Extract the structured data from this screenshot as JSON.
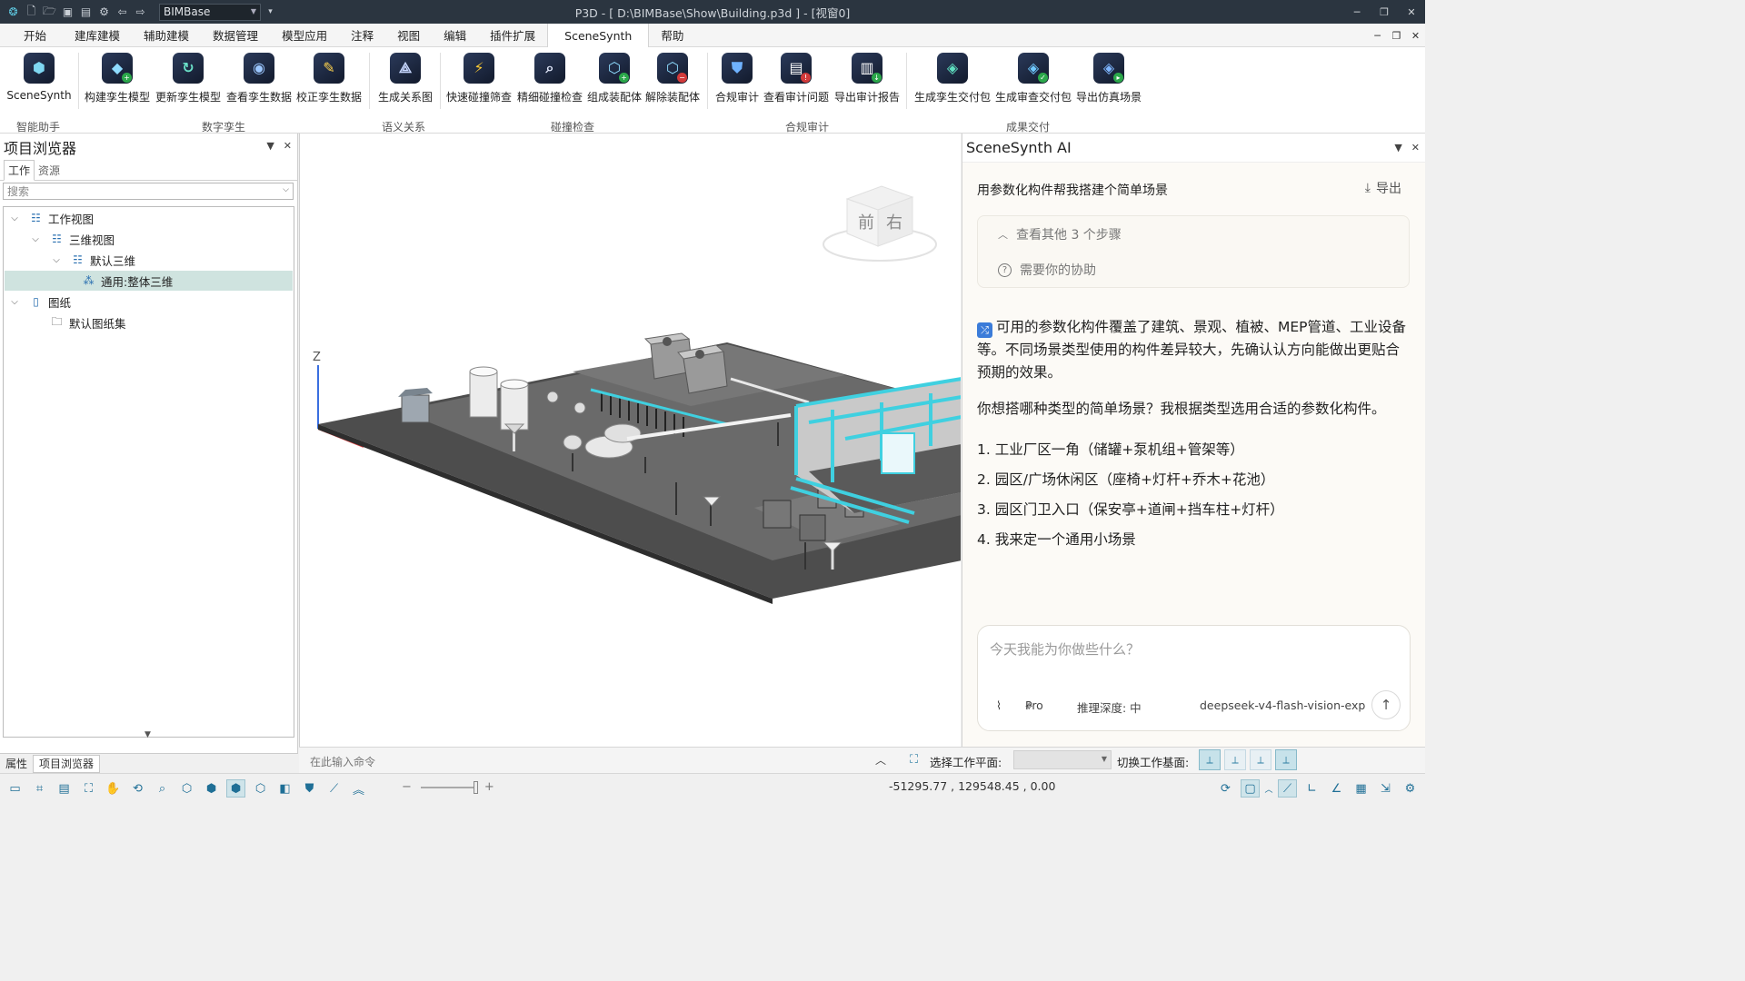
{
  "titlebar": {
    "app_select": "BIMBase",
    "title": "P3D - [ D:\\BIMBase\\Show\\Building.p3d ] - [视窗0]",
    "quick_access": [
      "app-logo-icon",
      "new-file-icon",
      "open-folder-icon",
      "save-icon",
      "save-as-icon",
      "settings-icon",
      "undo-icon",
      "redo-icon"
    ]
  },
  "menu": {
    "tabs": [
      "开始",
      "建库建模",
      "辅助建模",
      "数据管理",
      "模型应用",
      "注释",
      "视图",
      "编辑",
      "插件扩展",
      "SceneSynth",
      "帮助"
    ],
    "active": "SceneSynth"
  },
  "ribbon": {
    "buttons": [
      {
        "label": "SceneSynth",
        "icon": "scenesynth-cube-icon"
      },
      {
        "label": "构建孪生模型",
        "icon": "build-twin-model-icon"
      },
      {
        "label": "更新孪生模型",
        "icon": "update-twin-model-icon"
      },
      {
        "label": "查看孪生数据",
        "icon": "view-twin-data-icon"
      },
      {
        "label": "校正孪生数据",
        "icon": "correct-twin-data-icon"
      },
      {
        "label": "生成关系图",
        "icon": "relation-graph-icon"
      },
      {
        "label": "快速碰撞筛查",
        "icon": "quick-clash-icon"
      },
      {
        "label": "精细碰撞检查",
        "icon": "fine-clash-icon"
      },
      {
        "label": "组成装配体",
        "icon": "assemble-icon"
      },
      {
        "label": "解除装配体",
        "icon": "disassemble-icon"
      },
      {
        "label": "合规审计",
        "icon": "compliance-audit-icon"
      },
      {
        "label": "查看审计问题",
        "icon": "audit-issues-icon"
      },
      {
        "label": "导出审计报告",
        "icon": "export-audit-report-icon"
      },
      {
        "label": "生成孪生交付包",
        "icon": "twin-package-icon"
      },
      {
        "label": "生成审查交付包",
        "icon": "review-package-icon"
      },
      {
        "label": "导出仿真场景",
        "icon": "export-simulation-icon"
      }
    ],
    "groups": [
      "智能助手",
      "数字孪生",
      "语义关系",
      "碰撞检查",
      "合规审计",
      "成果交付"
    ]
  },
  "left_panel": {
    "title": "项目浏览器",
    "tabs": [
      "工作",
      "资源"
    ],
    "search_placeholder": "搜索",
    "tree": [
      {
        "label": "工作视图",
        "icon": "view-tree-icon"
      },
      {
        "label": "三维视图",
        "icon": "view-tree-icon"
      },
      {
        "label": "默认三维",
        "icon": "view-tree-icon"
      },
      {
        "label": "通用:整体三维",
        "icon": "3d-objects-icon"
      },
      {
        "label": "图纸",
        "icon": "sheet-icon"
      },
      {
        "label": "默认图纸集",
        "icon": "folder-icon"
      }
    ],
    "bottom_tabs": [
      "属性",
      "项目浏览器"
    ]
  },
  "viewport": {
    "view_cube": {
      "front": "前",
      "right": "右"
    },
    "axis_z": "Z"
  },
  "ai_panel": {
    "title": "SceneSynth AI",
    "user_prompt": "用参数化构件帮我搭建个简单场景",
    "export_label": "导出",
    "steps_more": "查看其他 3 个步骤",
    "need_help": "需要你的协助",
    "msg1": "可用的参数化构件覆盖了建筑、景观、植被、MEP管道、工业设备等。不同场景类型使用的构件差异较大，先确认认方向能做出更贴合预期的效果。",
    "msg2": "你想搭哪种类型的简单场景？我根据类型选用合适的参数化构件。",
    "options": [
      "1. 工业厂区一角（储罐+泵机组+管架等）",
      "2. 园区/广场休闲区（座椅+灯杆+乔木+花池）",
      "3. 园区门卫入口（保安亭+道闸+挡车柱+灯杆）",
      "4. 我来定一个通用小场景"
    ],
    "input_placeholder": "今天我能为你做些什么？",
    "mode": "Pro",
    "depth": "推理深度: 中",
    "model": "deepseek-v4-flash-vision-exp"
  },
  "cmdbar": {
    "placeholder": "在此输入命令",
    "workplane_label": "选择工作平面:",
    "switch_label": "切换工作基面:"
  },
  "statusbar": {
    "coords": "-51295.77 , 129548.45 , 0.00"
  },
  "colors": {
    "titlebar": "#2b3540",
    "accent": "#3b7cd9",
    "selection": "#cfe3df",
    "cyan_pipe": "#3fd0e0"
  }
}
